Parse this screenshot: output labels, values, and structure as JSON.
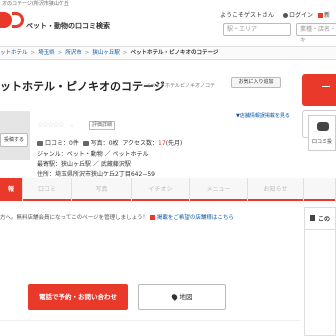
{
  "topstrip": "オのコテージ(所沢市狭山ケ丘",
  "header": {
    "site_name": "ペット・動物の口コミ検索",
    "welcome": "ようこそゲストさん",
    "login": "ログイン",
    "register": "新",
    "search_area_placeholder": "駅・エリア",
    "search_keyword_placeholder": "業種・店名・キ"
  },
  "breadcrumb": {
    "items": [
      "ットホテル",
      "埼玉県",
      "所沢市",
      "狭山ヶ丘駅"
    ],
    "current": "ペットホテル・ピノキオのコテージ"
  },
  "business": {
    "name": "ットホテル・ピノキオのコテージ",
    "kana": "(ペットホテルピノキオノコテ",
    "favorite_label": "お気に入り追加",
    "report_link": "▼店舗情報誤掲載を見る",
    "photo_caption": "写真",
    "photo_button": "投稿する",
    "stars": "☆☆☆☆☆",
    "score": "-",
    "unrated": "評価詳細",
    "reviews_label": "口コミ：",
    "reviews_value": "0件",
    "photos_label": "写真：",
    "photos_value": "0枚",
    "access_label": "アクセス数：",
    "access_value": "17",
    "access_unit": "(先月)",
    "genre_label": "ジャンル：",
    "genre_value": "ペット・動物 ／ ペットホテル",
    "station_label": "最寄駅：",
    "station_value": "狭山ヶ丘駅 ／ 武蔵藤沢駅",
    "address_label": "住所：",
    "address_value": "埼玉県所沢市狭山ケ丘2丁目642−59"
  },
  "comment_box": {
    "label": "口コミ投"
  },
  "tabs": [
    {
      "label": "報"
    },
    {
      "label": "口コミ"
    },
    {
      "label": "写真"
    },
    {
      "label": "イチオシ"
    },
    {
      "label": "メニュー"
    },
    {
      "label": "お知らせ"
    },
    {
      "label": ""
    }
  ],
  "notice": {
    "text": "方へ。無料店舗会員になってこのページを管理しましょう！",
    "link": "掲載をご希望の店舗様はこちら"
  },
  "side_panel": {
    "title": "この"
  },
  "actions": {
    "reserve": "電話で予約・お問い合わせ",
    "map": "地図"
  },
  "colors": {
    "accent": "#e8392a",
    "link": "#0b59a6"
  }
}
